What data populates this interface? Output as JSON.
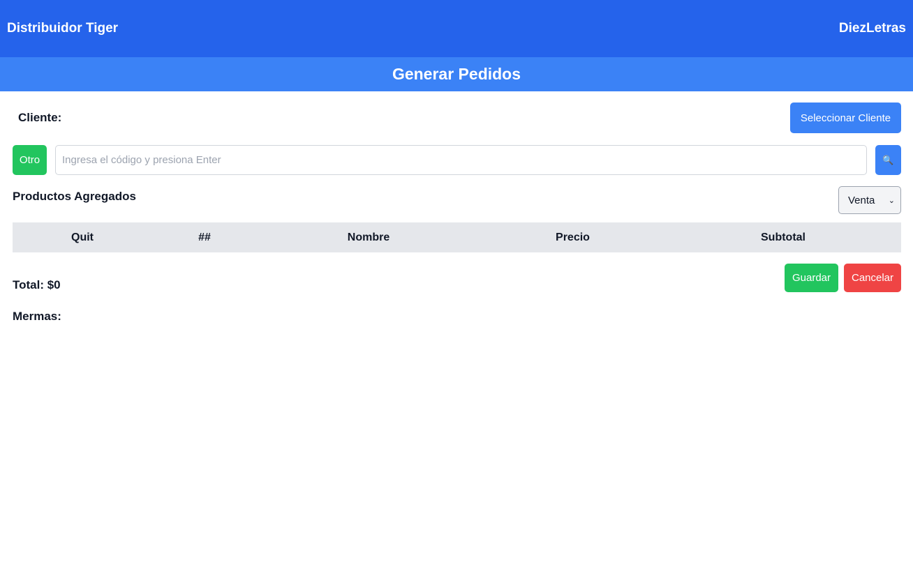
{
  "header": {
    "app_title": "Distribuidor Tiger",
    "user_name": "DiezLetras",
    "page_title": "Generar Pedidos"
  },
  "cliente": {
    "label": "Cliente:",
    "select_button": "Seleccionar Cliente"
  },
  "search": {
    "otro_label": "Otro",
    "placeholder": "Ingresa el código y presiona Enter",
    "value": "",
    "button_icon": "magnifier-icon",
    "button_glyph": "🔍"
  },
  "products": {
    "title": "Productos Agregados",
    "mode_select_value": "Venta",
    "columns": [
      "Quit",
      "##",
      "Nombre",
      "Precio",
      "Subtotal"
    ],
    "rows": []
  },
  "footer": {
    "total": "Total: $0",
    "mermas": "Mermas:",
    "save_label": "Guardar",
    "cancel_label": "Cancelar"
  },
  "colors": {
    "topbar": "#2563eb",
    "subbar": "#3b82f6",
    "primary": "#3b82f6",
    "success": "#22c55e",
    "danger": "#ef4444",
    "table_header": "#e5e7eb"
  }
}
